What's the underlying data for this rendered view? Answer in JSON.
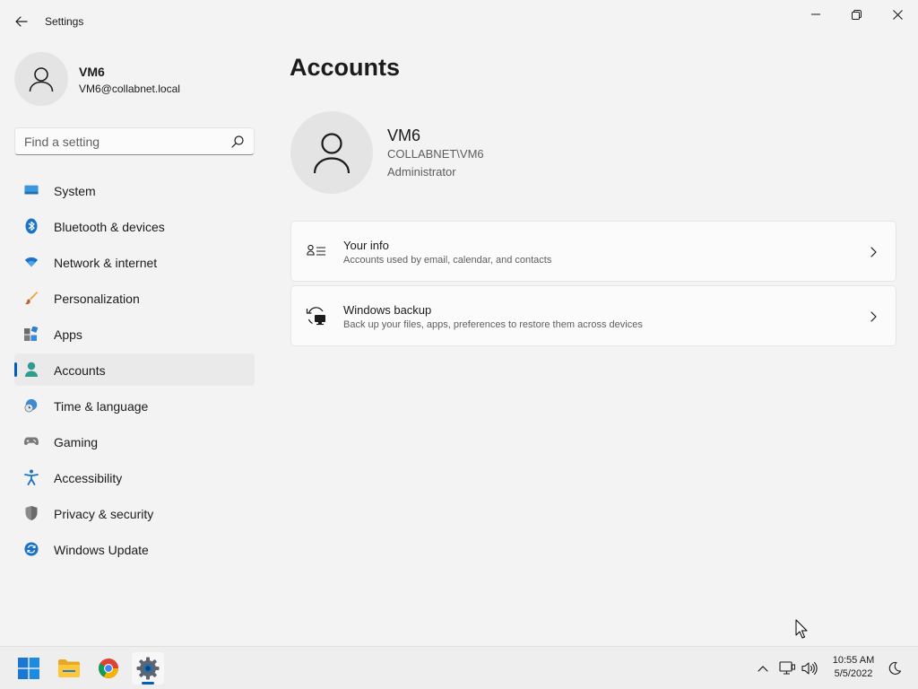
{
  "window": {
    "title": "Settings"
  },
  "profile": {
    "name": "VM6",
    "email": "VM6@collabnet.local"
  },
  "search": {
    "placeholder": "Find a setting"
  },
  "sidebar": {
    "items": [
      {
        "label": "System",
        "icon": "monitor-icon"
      },
      {
        "label": "Bluetooth & devices",
        "icon": "bluetooth-icon"
      },
      {
        "label": "Network & internet",
        "icon": "wifi-icon"
      },
      {
        "label": "Personalization",
        "icon": "brush-icon"
      },
      {
        "label": "Apps",
        "icon": "apps-icon"
      },
      {
        "label": "Accounts",
        "icon": "person-icon",
        "selected": true
      },
      {
        "label": "Time & language",
        "icon": "globe-clock-icon"
      },
      {
        "label": "Gaming",
        "icon": "gamepad-icon"
      },
      {
        "label": "Accessibility",
        "icon": "accessibility-icon"
      },
      {
        "label": "Privacy & security",
        "icon": "shield-icon"
      },
      {
        "label": "Windows Update",
        "icon": "update-icon"
      }
    ]
  },
  "main": {
    "title": "Accounts",
    "user": {
      "name": "VM6",
      "domain": "COLLABNET\\VM6",
      "role": "Administrator"
    },
    "cards": [
      {
        "title": "Your info",
        "subtitle": "Accounts used by email, calendar, and contacts",
        "icon": "contact-card-icon"
      },
      {
        "title": "Windows backup",
        "subtitle": "Back up your files, apps, preferences to restore them across devices",
        "icon": "sync-backup-icon"
      }
    ]
  },
  "taskbar": {
    "apps": [
      {
        "name": "start-button",
        "icon": "windows-logo-icon"
      },
      {
        "name": "file-explorer",
        "icon": "folder-icon"
      },
      {
        "name": "chrome",
        "icon": "chrome-icon"
      },
      {
        "name": "settings",
        "icon": "gear-icon",
        "active": true
      }
    ],
    "clock": {
      "time": "10:55 AM",
      "date": "5/5/2022"
    }
  },
  "colors": {
    "accent": "#005fb8",
    "background": "#f3f3f3",
    "card": "#fbfbfb"
  }
}
